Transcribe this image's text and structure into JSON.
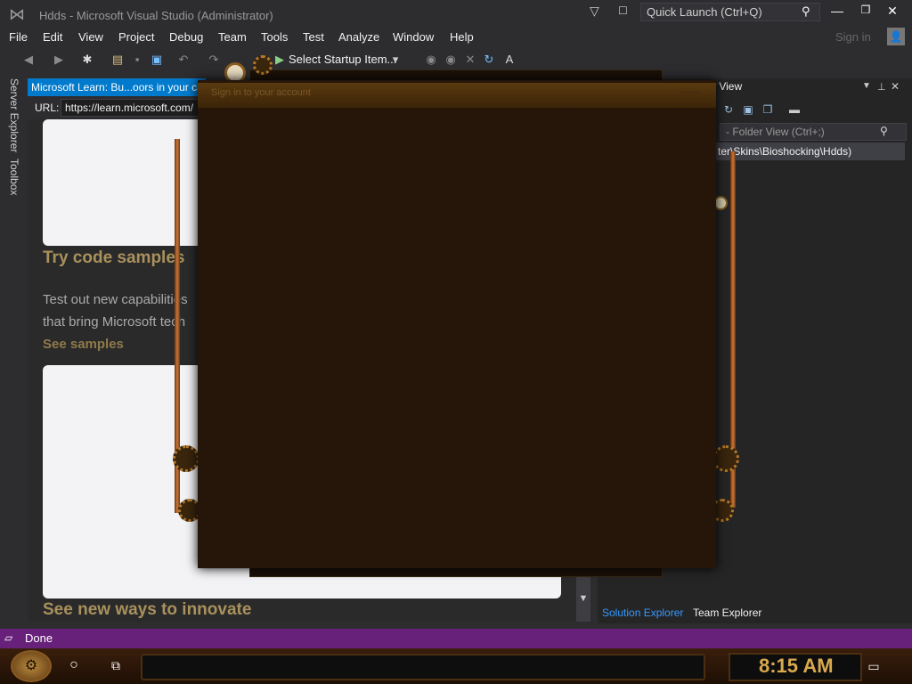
{
  "window": {
    "title": "Hdds - Microsoft Visual Studio  (Administrator)",
    "quick_launch_placeholder": "Quick Launch (Ctrl+Q)",
    "minimize_glyph": "—",
    "maximize_glyph": "❐",
    "close_glyph": "✕"
  },
  "menu": {
    "items": [
      "File",
      "Edit",
      "View",
      "Project",
      "Debug",
      "Team",
      "Tools",
      "Test",
      "Analyze",
      "Window",
      "Help"
    ],
    "sign_in": "Sign in"
  },
  "toolbar": {
    "startup_item": "Select Startup Item...",
    "startup_dropdown": "▾"
  },
  "left_tabs": {
    "server_explorer": "Server Explorer",
    "toolbox": "Toolbox"
  },
  "browser": {
    "tab_title": "Microsoft Learn: Bu...oors in your ca",
    "url_label": "URL:",
    "url": "https://learn.microsoft.com/",
    "heading1": "Try code samples",
    "body_line1": "Test out new capabilities",
    "body_line2": "that bring Microsoft tech",
    "link1": "See samples",
    "heading2": "See new ways to innovate"
  },
  "solution_explorer": {
    "header": "r View",
    "search_placeholder": "- Folder View (Ctrl+;)",
    "tree_root": "ter\\Skins\\Bioshocking\\Hdds)",
    "tab_solution": "Solution Explorer",
    "tab_team": "Team Explorer"
  },
  "overlay": {
    "title": "Sign in to your account"
  },
  "status": {
    "text": "Done"
  },
  "taskbar": {
    "clock": "8:15 AM"
  },
  "colors": {
    "accent": "#007acc",
    "status_bar": "#68217a",
    "heading_gold": "#a9915c",
    "clock_gold": "#d9a94e"
  }
}
